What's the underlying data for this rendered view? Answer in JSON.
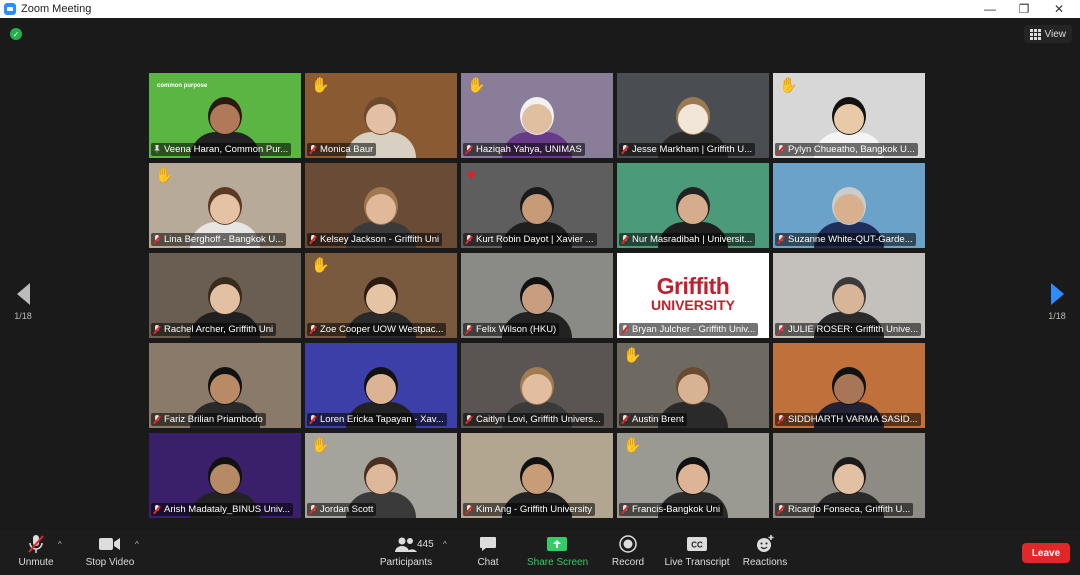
{
  "window": {
    "title": "Zoom Meeting"
  },
  "header": {
    "view_label": "View"
  },
  "pagination": {
    "left": "1/18",
    "right": "1/18"
  },
  "participants": [
    {
      "name": "Veena Haran, Common Pur...",
      "status": "pinned",
      "reaction": "",
      "bg": "#5bb543",
      "shirt": "#222",
      "skin": "#b07a5a",
      "hair": "#2a1a10",
      "brand": "common purpose",
      "active": true
    },
    {
      "name": "Monica Baur",
      "status": "muted",
      "reaction": "wave",
      "bg": "#8a5a33",
      "shirt": "#d9d0c4",
      "skin": "#e3c0a5",
      "hair": "#6b4a2c"
    },
    {
      "name": "Haziqah Yahya, UNIMAS",
      "status": "muted",
      "reaction": "wave",
      "bg": "#8a7d9a",
      "shirt": "#6a3a8a",
      "skin": "#e0bfa0",
      "hair": "#f1f1f1"
    },
    {
      "name": "Jesse Markham | Griffith U...",
      "status": "muted",
      "reaction": "",
      "bg": "#4a4e52",
      "shirt": "#2a2a2a",
      "skin": "#f2e6d8",
      "hair": "#9a7a50"
    },
    {
      "name": "Pylyn Chueatho, Bangkok U...",
      "status": "muted",
      "reaction": "wave",
      "bg": "#d7d7d7",
      "shirt": "#f5f5f5",
      "skin": "#e8c9a8",
      "hair": "#111"
    },
    {
      "name": "Lina Berghoff - Bangkok U...",
      "status": "muted",
      "reaction": "wave",
      "bg": "#b8aa98",
      "shirt": "#e8e6e2",
      "skin": "#e6c2a4",
      "hair": "#5a3a24"
    },
    {
      "name": "Kelsey Jackson - Griffith Uni",
      "status": "muted",
      "reaction": "",
      "bg": "#6a4b36",
      "shirt": "#3a3a3a",
      "skin": "#e0b89a",
      "hair": "#a07850"
    },
    {
      "name": "Kurt Robin Dayot | Xavier ...",
      "status": "muted",
      "reaction": "heart",
      "bg": "#5e5e5e",
      "shirt": "#1f1f1f",
      "skin": "#c79a78",
      "hair": "#1a1a1a"
    },
    {
      "name": "Nur Masradibah | Universit...",
      "status": "muted",
      "reaction": "",
      "bg": "#4b9a7a",
      "shirt": "#1f1f1f",
      "skin": "#d5ad8c",
      "hair": "#222"
    },
    {
      "name": "Suzanne White-QUT-Garde...",
      "status": "muted",
      "reaction": "",
      "bg": "#6aa2c9",
      "shirt": "#1f2f5a",
      "skin": "#d9b08e",
      "hair": "#ccc"
    },
    {
      "name": "Rachel Archer, Griffith Uni",
      "status": "muted",
      "reaction": "",
      "bg": "#6a5e52",
      "shirt": "#202020",
      "skin": "#e4c0a2",
      "hair": "#3a2a1a"
    },
    {
      "name": "Zoe Cooper UOW Westpac...",
      "status": "muted",
      "reaction": "wave",
      "bg": "#7a5a3e",
      "shirt": "#2a2a2a",
      "skin": "#e5c3a5",
      "hair": "#2a1a10"
    },
    {
      "name": "Felix Wilson (HKU)",
      "status": "muted",
      "reaction": "",
      "bg": "#8a8a86",
      "shirt": "#222",
      "skin": "#c89e7e",
      "hair": "#111"
    },
    {
      "name": "Bryan Julcher - Griffith Univ...",
      "status": "muted",
      "reaction": "",
      "bg": "#ffffff",
      "shirt": "",
      "skin": "",
      "hair": "",
      "logo": "Griffith",
      "logo_sub": "UNIVERSITY"
    },
    {
      "name": "JULIE ROSER: Griffith Unive...",
      "status": "muted",
      "reaction": "",
      "bg": "#c4c0bc",
      "shirt": "#2a2a2a",
      "skin": "#d9b598",
      "hair": "#3a3a3a"
    },
    {
      "name": "Fariz Brilian Priambodo",
      "status": "muted",
      "reaction": "",
      "bg": "#8a7a6a",
      "shirt": "#2a2a2a",
      "skin": "#b98a66",
      "hair": "#111"
    },
    {
      "name": "Loren Ericka Tapayan - Xav...",
      "status": "muted",
      "reaction": "",
      "bg": "#3c3fa8",
      "shirt": "#222",
      "skin": "#ddb493",
      "hair": "#111"
    },
    {
      "name": "Caitlyn Lovi, Griffith Univers...",
      "status": "muted",
      "reaction": "",
      "bg": "#5a5552",
      "shirt": "#3a3a3a",
      "skin": "#e2bda0",
      "hair": "#a07c50"
    },
    {
      "name": "Austin Brent",
      "status": "muted",
      "reaction": "wave",
      "bg": "#6e6a62",
      "shirt": "#2a2a2a",
      "skin": "#d7b394",
      "hair": "#6a4a30"
    },
    {
      "name": "SIDDHARTH VARMA SASID...",
      "status": "muted",
      "reaction": "",
      "bg": "#c0703a",
      "shirt": "#223",
      "skin": "#a87656",
      "hair": "#111"
    },
    {
      "name": "Arish Madataly_BINUS Univ...",
      "status": "muted",
      "reaction": "",
      "bg": "#3a1f6a",
      "shirt": "#222",
      "skin": "#b78a66",
      "hair": "#111"
    },
    {
      "name": "Jordan Scott",
      "status": "muted",
      "reaction": "wave",
      "bg": "#a4a49c",
      "shirt": "#3a3a3a",
      "skin": "#ddb89a",
      "hair": "#4a3020"
    },
    {
      "name": "Kim Ang - Griffith University",
      "status": "muted",
      "reaction": "",
      "bg": "#b3a690",
      "shirt": "#222",
      "skin": "#c99c78",
      "hair": "#111"
    },
    {
      "name": "Francis-Bangkok Uni",
      "status": "muted",
      "reaction": "wave",
      "bg": "#9a9a92",
      "shirt": "#2a2a2a",
      "skin": "#ddb596",
      "hair": "#111"
    },
    {
      "name": "Ricardo Fonseca, Griffith U...",
      "status": "muted",
      "reaction": "",
      "bg": "#8e8a84",
      "shirt": "#2a2a2a",
      "skin": "#e2c0a4",
      "hair": "#1a1a1a"
    }
  ],
  "toolbar": {
    "unmute": "Unmute",
    "stop_video": "Stop Video",
    "participants": "Participants",
    "participants_count": "445",
    "chat": "Chat",
    "share_screen": "Share Screen",
    "record": "Record",
    "live_transcript": "Live Transcript",
    "reactions": "Reactions",
    "leave": "Leave"
  },
  "colors": {
    "accent": "#2d8cff",
    "share": "#33cc66",
    "leave": "#e02828",
    "active_speaker": "#e7f13a"
  }
}
